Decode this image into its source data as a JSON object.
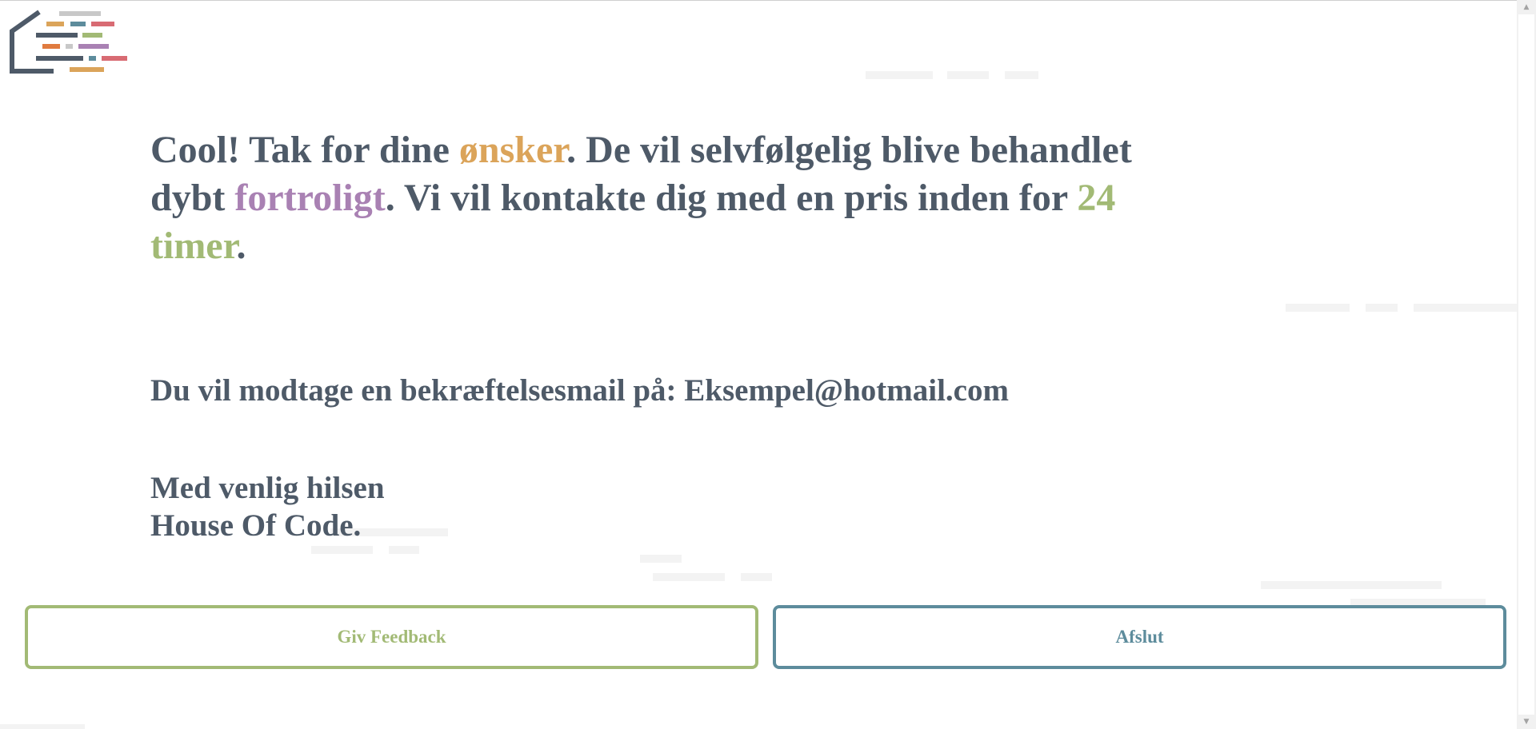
{
  "icons": {
    "logo": "house-of-code-logo-icon",
    "scroll_up": "scroll-up-arrow-icon",
    "scroll_down": "scroll-down-arrow-icon"
  },
  "colors": {
    "text": "#4e5a68",
    "orange": "#dba45a",
    "purple": "#a981b3",
    "green": "#a2ba75",
    "teal": "#5d8c9c",
    "red": "#d86b73"
  },
  "headline": {
    "part1": "Cool! Tak for dine ",
    "highlight1": "ønsker",
    "part2": ". De vil selvfølgelig blive behandlet dybt ",
    "highlight2": "fortroligt",
    "part3": ". Vi vil kontakte dig med en pris inden for ",
    "highlight3": "24 timer",
    "part4": "."
  },
  "confirmation": {
    "label": "Du vil modtage en bekræftelsesmail på: ",
    "email": "Eksempel@hotmail.com"
  },
  "signoff": {
    "line1": "Med venlig hilsen",
    "line2": "House Of Code."
  },
  "buttons": {
    "feedback_label": "Giv Feedback",
    "exit_label": "Afslut"
  }
}
